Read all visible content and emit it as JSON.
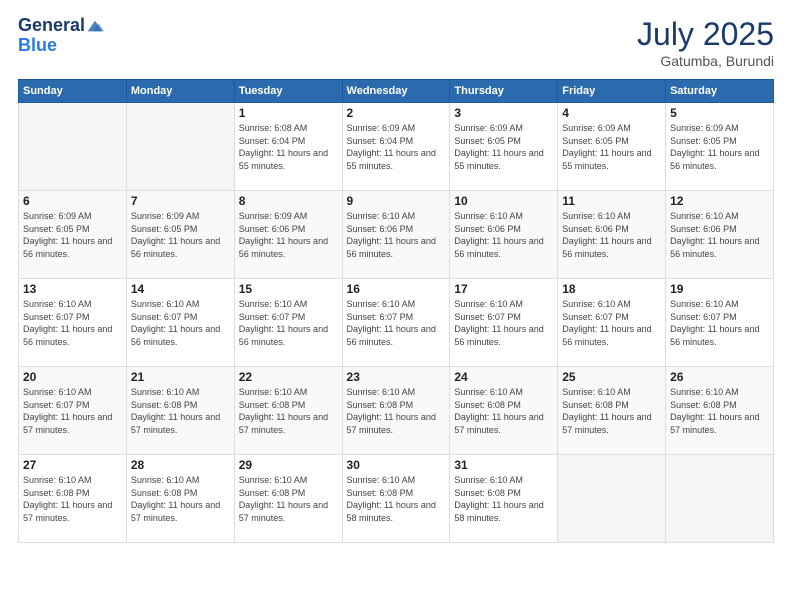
{
  "logo": {
    "line1": "General",
    "line2": "Blue"
  },
  "header": {
    "month": "July 2025",
    "location": "Gatumba, Burundi"
  },
  "weekdays": [
    "Sunday",
    "Monday",
    "Tuesday",
    "Wednesday",
    "Thursday",
    "Friday",
    "Saturday"
  ],
  "weeks": [
    [
      {
        "day": "",
        "sunrise": "",
        "sunset": "",
        "daylight": ""
      },
      {
        "day": "",
        "sunrise": "",
        "sunset": "",
        "daylight": ""
      },
      {
        "day": "1",
        "sunrise": "Sunrise: 6:08 AM",
        "sunset": "Sunset: 6:04 PM",
        "daylight": "Daylight: 11 hours and 55 minutes."
      },
      {
        "day": "2",
        "sunrise": "Sunrise: 6:09 AM",
        "sunset": "Sunset: 6:04 PM",
        "daylight": "Daylight: 11 hours and 55 minutes."
      },
      {
        "day": "3",
        "sunrise": "Sunrise: 6:09 AM",
        "sunset": "Sunset: 6:05 PM",
        "daylight": "Daylight: 11 hours and 55 minutes."
      },
      {
        "day": "4",
        "sunrise": "Sunrise: 6:09 AM",
        "sunset": "Sunset: 6:05 PM",
        "daylight": "Daylight: 11 hours and 55 minutes."
      },
      {
        "day": "5",
        "sunrise": "Sunrise: 6:09 AM",
        "sunset": "Sunset: 6:05 PM",
        "daylight": "Daylight: 11 hours and 56 minutes."
      }
    ],
    [
      {
        "day": "6",
        "sunrise": "Sunrise: 6:09 AM",
        "sunset": "Sunset: 6:05 PM",
        "daylight": "Daylight: 11 hours and 56 minutes."
      },
      {
        "day": "7",
        "sunrise": "Sunrise: 6:09 AM",
        "sunset": "Sunset: 6:05 PM",
        "daylight": "Daylight: 11 hours and 56 minutes."
      },
      {
        "day": "8",
        "sunrise": "Sunrise: 6:09 AM",
        "sunset": "Sunset: 6:06 PM",
        "daylight": "Daylight: 11 hours and 56 minutes."
      },
      {
        "day": "9",
        "sunrise": "Sunrise: 6:10 AM",
        "sunset": "Sunset: 6:06 PM",
        "daylight": "Daylight: 11 hours and 56 minutes."
      },
      {
        "day": "10",
        "sunrise": "Sunrise: 6:10 AM",
        "sunset": "Sunset: 6:06 PM",
        "daylight": "Daylight: 11 hours and 56 minutes."
      },
      {
        "day": "11",
        "sunrise": "Sunrise: 6:10 AM",
        "sunset": "Sunset: 6:06 PM",
        "daylight": "Daylight: 11 hours and 56 minutes."
      },
      {
        "day": "12",
        "sunrise": "Sunrise: 6:10 AM",
        "sunset": "Sunset: 6:06 PM",
        "daylight": "Daylight: 11 hours and 56 minutes."
      }
    ],
    [
      {
        "day": "13",
        "sunrise": "Sunrise: 6:10 AM",
        "sunset": "Sunset: 6:07 PM",
        "daylight": "Daylight: 11 hours and 56 minutes."
      },
      {
        "day": "14",
        "sunrise": "Sunrise: 6:10 AM",
        "sunset": "Sunset: 6:07 PM",
        "daylight": "Daylight: 11 hours and 56 minutes."
      },
      {
        "day": "15",
        "sunrise": "Sunrise: 6:10 AM",
        "sunset": "Sunset: 6:07 PM",
        "daylight": "Daylight: 11 hours and 56 minutes."
      },
      {
        "day": "16",
        "sunrise": "Sunrise: 6:10 AM",
        "sunset": "Sunset: 6:07 PM",
        "daylight": "Daylight: 11 hours and 56 minutes."
      },
      {
        "day": "17",
        "sunrise": "Sunrise: 6:10 AM",
        "sunset": "Sunset: 6:07 PM",
        "daylight": "Daylight: 11 hours and 56 minutes."
      },
      {
        "day": "18",
        "sunrise": "Sunrise: 6:10 AM",
        "sunset": "Sunset: 6:07 PM",
        "daylight": "Daylight: 11 hours and 56 minutes."
      },
      {
        "day": "19",
        "sunrise": "Sunrise: 6:10 AM",
        "sunset": "Sunset: 6:07 PM",
        "daylight": "Daylight: 11 hours and 56 minutes."
      }
    ],
    [
      {
        "day": "20",
        "sunrise": "Sunrise: 6:10 AM",
        "sunset": "Sunset: 6:07 PM",
        "daylight": "Daylight: 11 hours and 57 minutes."
      },
      {
        "day": "21",
        "sunrise": "Sunrise: 6:10 AM",
        "sunset": "Sunset: 6:08 PM",
        "daylight": "Daylight: 11 hours and 57 minutes."
      },
      {
        "day": "22",
        "sunrise": "Sunrise: 6:10 AM",
        "sunset": "Sunset: 6:08 PM",
        "daylight": "Daylight: 11 hours and 57 minutes."
      },
      {
        "day": "23",
        "sunrise": "Sunrise: 6:10 AM",
        "sunset": "Sunset: 6:08 PM",
        "daylight": "Daylight: 11 hours and 57 minutes."
      },
      {
        "day": "24",
        "sunrise": "Sunrise: 6:10 AM",
        "sunset": "Sunset: 6:08 PM",
        "daylight": "Daylight: 11 hours and 57 minutes."
      },
      {
        "day": "25",
        "sunrise": "Sunrise: 6:10 AM",
        "sunset": "Sunset: 6:08 PM",
        "daylight": "Daylight: 11 hours and 57 minutes."
      },
      {
        "day": "26",
        "sunrise": "Sunrise: 6:10 AM",
        "sunset": "Sunset: 6:08 PM",
        "daylight": "Daylight: 11 hours and 57 minutes."
      }
    ],
    [
      {
        "day": "27",
        "sunrise": "Sunrise: 6:10 AM",
        "sunset": "Sunset: 6:08 PM",
        "daylight": "Daylight: 11 hours and 57 minutes."
      },
      {
        "day": "28",
        "sunrise": "Sunrise: 6:10 AM",
        "sunset": "Sunset: 6:08 PM",
        "daylight": "Daylight: 11 hours and 57 minutes."
      },
      {
        "day": "29",
        "sunrise": "Sunrise: 6:10 AM",
        "sunset": "Sunset: 6:08 PM",
        "daylight": "Daylight: 11 hours and 57 minutes."
      },
      {
        "day": "30",
        "sunrise": "Sunrise: 6:10 AM",
        "sunset": "Sunset: 6:08 PM",
        "daylight": "Daylight: 11 hours and 58 minutes."
      },
      {
        "day": "31",
        "sunrise": "Sunrise: 6:10 AM",
        "sunset": "Sunset: 6:08 PM",
        "daylight": "Daylight: 11 hours and 58 minutes."
      },
      {
        "day": "",
        "sunrise": "",
        "sunset": "",
        "daylight": ""
      },
      {
        "day": "",
        "sunrise": "",
        "sunset": "",
        "daylight": ""
      }
    ]
  ]
}
